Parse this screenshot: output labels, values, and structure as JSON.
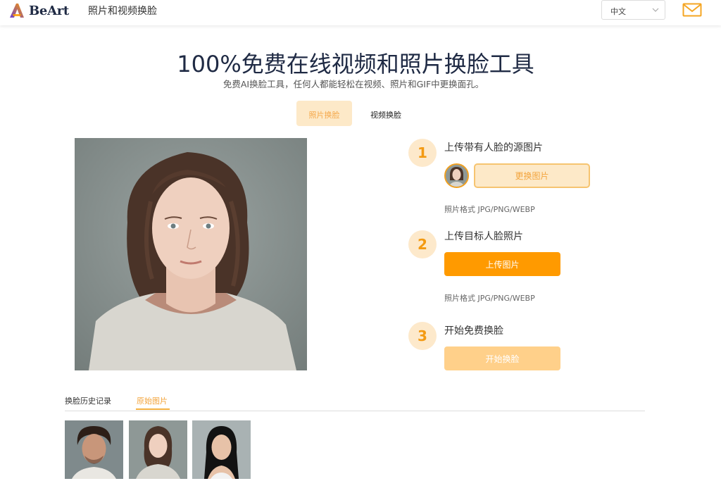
{
  "header": {
    "brand": "BeArt",
    "nav_title": "照片和视频换脸",
    "language": "中文",
    "colors": {
      "brand_purple": "#6a3fd0",
      "brand_orange": "#ff9a00"
    }
  },
  "hero": {
    "title": "100%免费在线视频和照片换脸工具",
    "subtitle": "免费AI换脸工具，任何人都能轻松在视频、照片和GIF中更换面孔。"
  },
  "mode_tabs": [
    {
      "label": "照片换脸",
      "active": true
    },
    {
      "label": "视频换脸",
      "active": false
    }
  ],
  "steps": [
    {
      "number": "1",
      "title": "上传带有人脸的源图片",
      "button": "更换图片",
      "format": "照片格式 JPG/PNG/WEBP"
    },
    {
      "number": "2",
      "title": "上传目标人脸照片",
      "button": "上传图片",
      "format": "照片格式 JPG/PNG/WEBP"
    },
    {
      "number": "3",
      "title": "开始免费换脸",
      "button": "开始换脸"
    }
  ],
  "history_tabs": [
    {
      "label": "换脸历史记录",
      "active": false
    },
    {
      "label": "原始图片",
      "active": true
    }
  ],
  "gallery": [
    {
      "icon": "man-curly-hair-portrait"
    },
    {
      "icon": "woman-brown-hair-portrait"
    },
    {
      "icon": "woman-black-hair-portrait"
    }
  ],
  "accent_color": "#ff9a00"
}
